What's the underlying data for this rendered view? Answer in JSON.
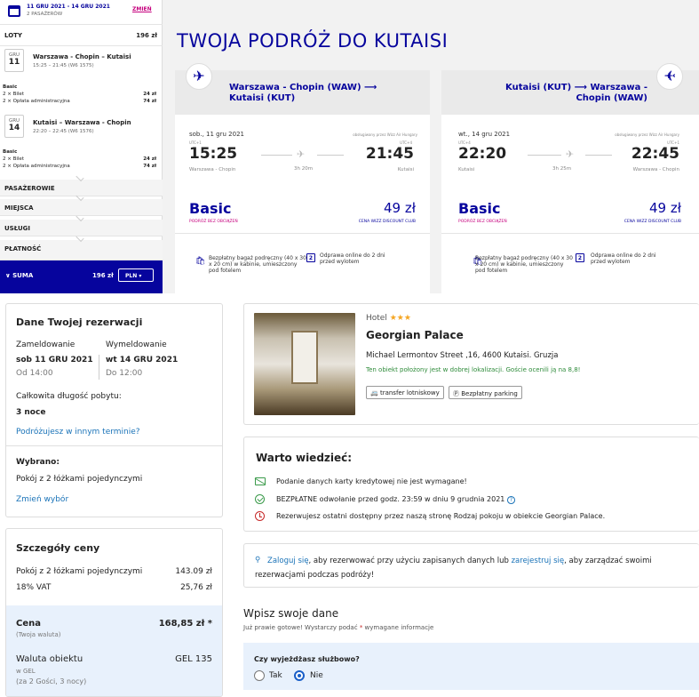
{
  "sidebar": {
    "dates": "11 GRU 2021 - 14 GRU 2021",
    "passengers": "2 PASAŻERÓW",
    "change_label": "ZMIEŃ",
    "flights_label": "LOTY",
    "flights_total": "196 zł",
    "outbound": {
      "month": "GRU",
      "day": "11",
      "route": "Warszawa - Chopin – Kutaisi",
      "time": "15:25 – 21:45 (W6 1575)",
      "fare_name": "Basic",
      "lines": [
        {
          "label": "2 × Bilet",
          "amount": "24 zł"
        },
        {
          "label": "2 × Opłata administracyjna",
          "amount": "74 zł"
        }
      ]
    },
    "inbound": {
      "month": "GRU",
      "day": "14",
      "route": "Kutaisi – Warszawa - Chopin",
      "time": "22:20 – 22:45 (W6 1576)",
      "fare_name": "Basic",
      "lines": [
        {
          "label": "2 × Bilet",
          "amount": "24 zł"
        },
        {
          "label": "2 × Opłata administracyjna",
          "amount": "74 zł"
        }
      ]
    },
    "sections": [
      "PASAŻEROWIE",
      "MIEJSCA",
      "USŁUGI",
      "PŁATNOŚĆ"
    ],
    "sum_label": "SUMA",
    "sum_amount": "196 zł",
    "currency": "PLN"
  },
  "page_title": "TWOJA PODRÓŻ DO KUTAISI",
  "flight_cards": [
    {
      "title_line1": "Warszawa - Chopin (WAW) ⟶",
      "title_line2": "Kutaisi (KUT)",
      "date": "sob., 11 gru 2021",
      "operator": "obsługiwany przez Wizz Air Hungary",
      "dep_utc": "UTC+1",
      "arr_utc": "UTC+4",
      "dep_time": "15:25",
      "arr_time": "21:45",
      "dep_city": "Warszawa - Chopin",
      "arr_city": "Kutaisi",
      "duration": "3h 20m",
      "fare": "Basic",
      "fare_sub": "PODRÓŻ BEZ OBCIĄŻEŃ",
      "price": "49 zł",
      "club": "CENA WIZZ DISCOUNT CLUB",
      "bag_text": "Bezpłatny bagaż podręczny (40 x 30 x 20 cm) w kabinie, umieszczony pod fotelem",
      "checkin_text": "Odprawa online do 2 dni przed wylotem",
      "checkin_num": "2"
    },
    {
      "title_line1": "Kutaisi (KUT) ⟶ Warszawa -",
      "title_line2": "Chopin (WAW)",
      "date": "wt., 14 gru 2021",
      "operator": "obsługiwany przez Wizz Air Hungary",
      "dep_utc": "UTC+4",
      "arr_utc": "UTC+1",
      "dep_time": "22:20",
      "arr_time": "22:45",
      "dep_city": "Kutaisi",
      "arr_city": "Warszawa - Chopin",
      "duration": "3h 25m",
      "fare": "Basic",
      "fare_sub": "PODRÓŻ BEZ OBCIĄŻEŃ",
      "price": "49 zł",
      "club": "CENA WIZZ DISCOUNT CLUB",
      "bag_text": "Bezpłatny bagaż podręczny (40 x 30 x 20 cm) w kabinie, umieszczony pod fotelem",
      "checkin_text": "Odprawa online do 2 dni przed wylotem",
      "checkin_num": "2"
    }
  ],
  "reservation": {
    "title": "Dane Twojej rezerwacji",
    "checkin_label": "Zameldowanie",
    "checkin_date": "sob 11 GRU 2021",
    "checkin_time": "Od 14:00",
    "checkout_label": "Wymeldowanie",
    "checkout_date": "wt 14 GRU 2021",
    "checkout_time": "Do 12:00",
    "length_label": "Całkowita długość pobytu:",
    "length_value": "3 noce",
    "other_dates_link": "Podróżujesz w innym terminie?",
    "selected_label": "Wybrano:",
    "selected_value": "Pokój z 2 łóżkami pojedynczymi",
    "change_choice_link": "Zmień wybór"
  },
  "price_details": {
    "title": "Szczegóły ceny",
    "rows": [
      {
        "label": "Pokój z 2 łóżkami pojedynczymi",
        "value": "143.09 zł"
      },
      {
        "label": "18% VAT",
        "value": "25,76 zł"
      }
    ],
    "total_label": "Cena",
    "total_sub": "(Twoja waluta)",
    "total_value": "168,85 zł *",
    "local_label": "Waluta obiektu",
    "local_sub1": "w GEL",
    "local_sub2": "(za 2 Gości,   3 nocy)",
    "local_value": "GEL 135"
  },
  "hotel": {
    "type": "Hotel",
    "stars": "★★★",
    "name": "Georgian Palace",
    "address": "Michael Lermontov Street ,16, 4600 Kutaisi. Gruzja",
    "location_note": "Ten obiekt położony jest w dobrej lokalizacji. Goście ocenili ją na 8,8!",
    "amenities": [
      "transfer lotniskowy",
      "Bezpłatny parking"
    ]
  },
  "good_to_know": {
    "title": "Warto wiedzieć:",
    "items": [
      "Podanie danych karty kredytowej nie jest wymagane!",
      "BEZPŁATNE odwołanie przed godz. 23:59 w dniu 9 grudnia 2021",
      "Rezerwujesz ostatni dostępny przez naszą stronę Rodzaj pokoju w obiekcie Georgian Palace."
    ]
  },
  "login": {
    "login_link": "Zaloguj się",
    "mid_text": ", aby rezerwować przy użyciu zapisanych danych lub ",
    "register_link": "zarejestruj się",
    "end_text": ", aby zarządzać swoimi",
    "line2": "rezerwacjami podczas podróży!"
  },
  "form": {
    "title": "Wpisz swoje dane",
    "subtitle_pre": "Już prawie gotowe! Wystarczy podać ",
    "asterisk": "*",
    "subtitle_post": " wymagane informacje",
    "business_question": "Czy wyjeżdżasz służbowo?",
    "option_yes": "Tak",
    "option_no": "Nie",
    "selected": "Nie"
  },
  "colors": {
    "wizz_blue": "#06049d",
    "wizz_pink": "#c6007e",
    "link_blue": "#1a73b8",
    "green": "#3a9a4a"
  }
}
